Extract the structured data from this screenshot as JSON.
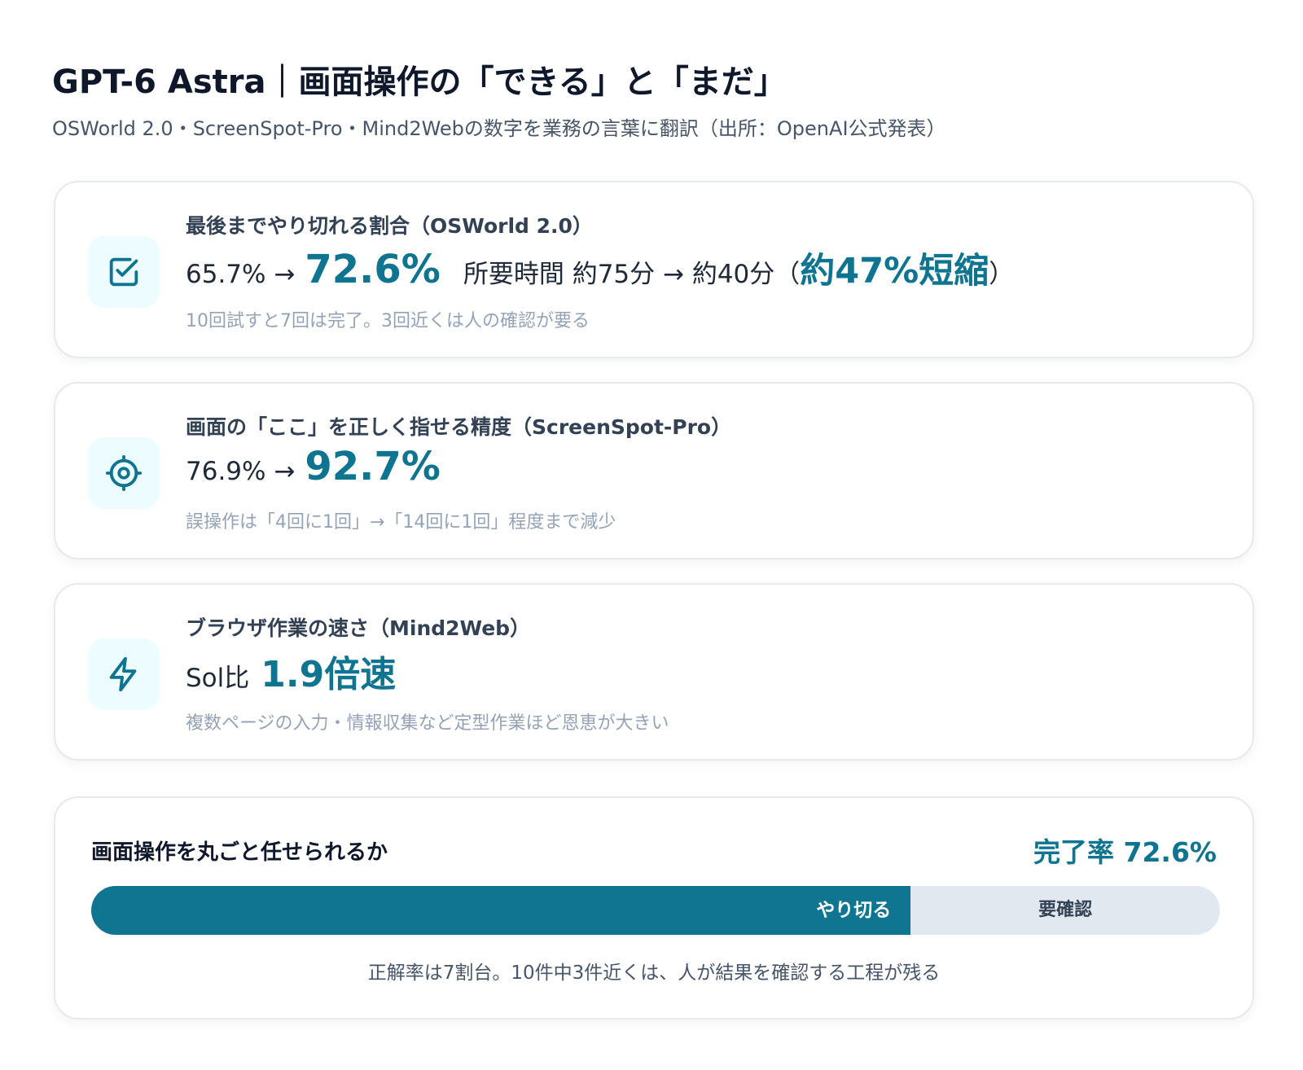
{
  "header": {
    "title": "GPT-6 Astra｜画面操作の「できる」と「まだ」",
    "subtitle": "OSWorld 2.0・ScreenSpot-Pro・Mind2Webの数字を業務の言葉に翻訳（出所：OpenAI公式発表）"
  },
  "cards": [
    {
      "icon": "checkbox-icon",
      "label": "最後までやり切れる割合（OSWorld 2.0）",
      "before": "65.7% →",
      "after": "72.6%",
      "extra": "所要時間 約75分 → 約40分（",
      "extra_highlight": "約47%短縮",
      "extra_close": "）",
      "note": "10回試すと7回は完了。3回近くは人の確認が要る"
    },
    {
      "icon": "target-icon",
      "label": "画面の「ここ」を正しく指せる精度（ScreenSpot-Pro）",
      "before": "76.9% →",
      "after": "92.7%",
      "note": "誤操作は「4回に1回」→「14回に1回」程度まで減少"
    },
    {
      "icon": "lightning-icon",
      "label": "ブラウザ作業の速さ（Mind2Web）",
      "before": "Sol比",
      "after": "1.9倍速",
      "note": "複数ページの入力・情報収集など定型作業ほど恩恵が大きい"
    }
  ],
  "summary": {
    "title": "画面操作を丸ごと任せられるか",
    "rate_label": "完了率 72.6%",
    "completion_fraction": 0.726,
    "done_label": "やり切る",
    "rest_label": "要確認",
    "note": "正解率は7割台。10件中3件近くは、人が結果を確認する工程が残る"
  },
  "colors": {
    "accent": "#0e7490",
    "bar_fill": "#0f7590",
    "bar_track": "#e2e8f0",
    "icon_bg": "#ecfcff"
  }
}
